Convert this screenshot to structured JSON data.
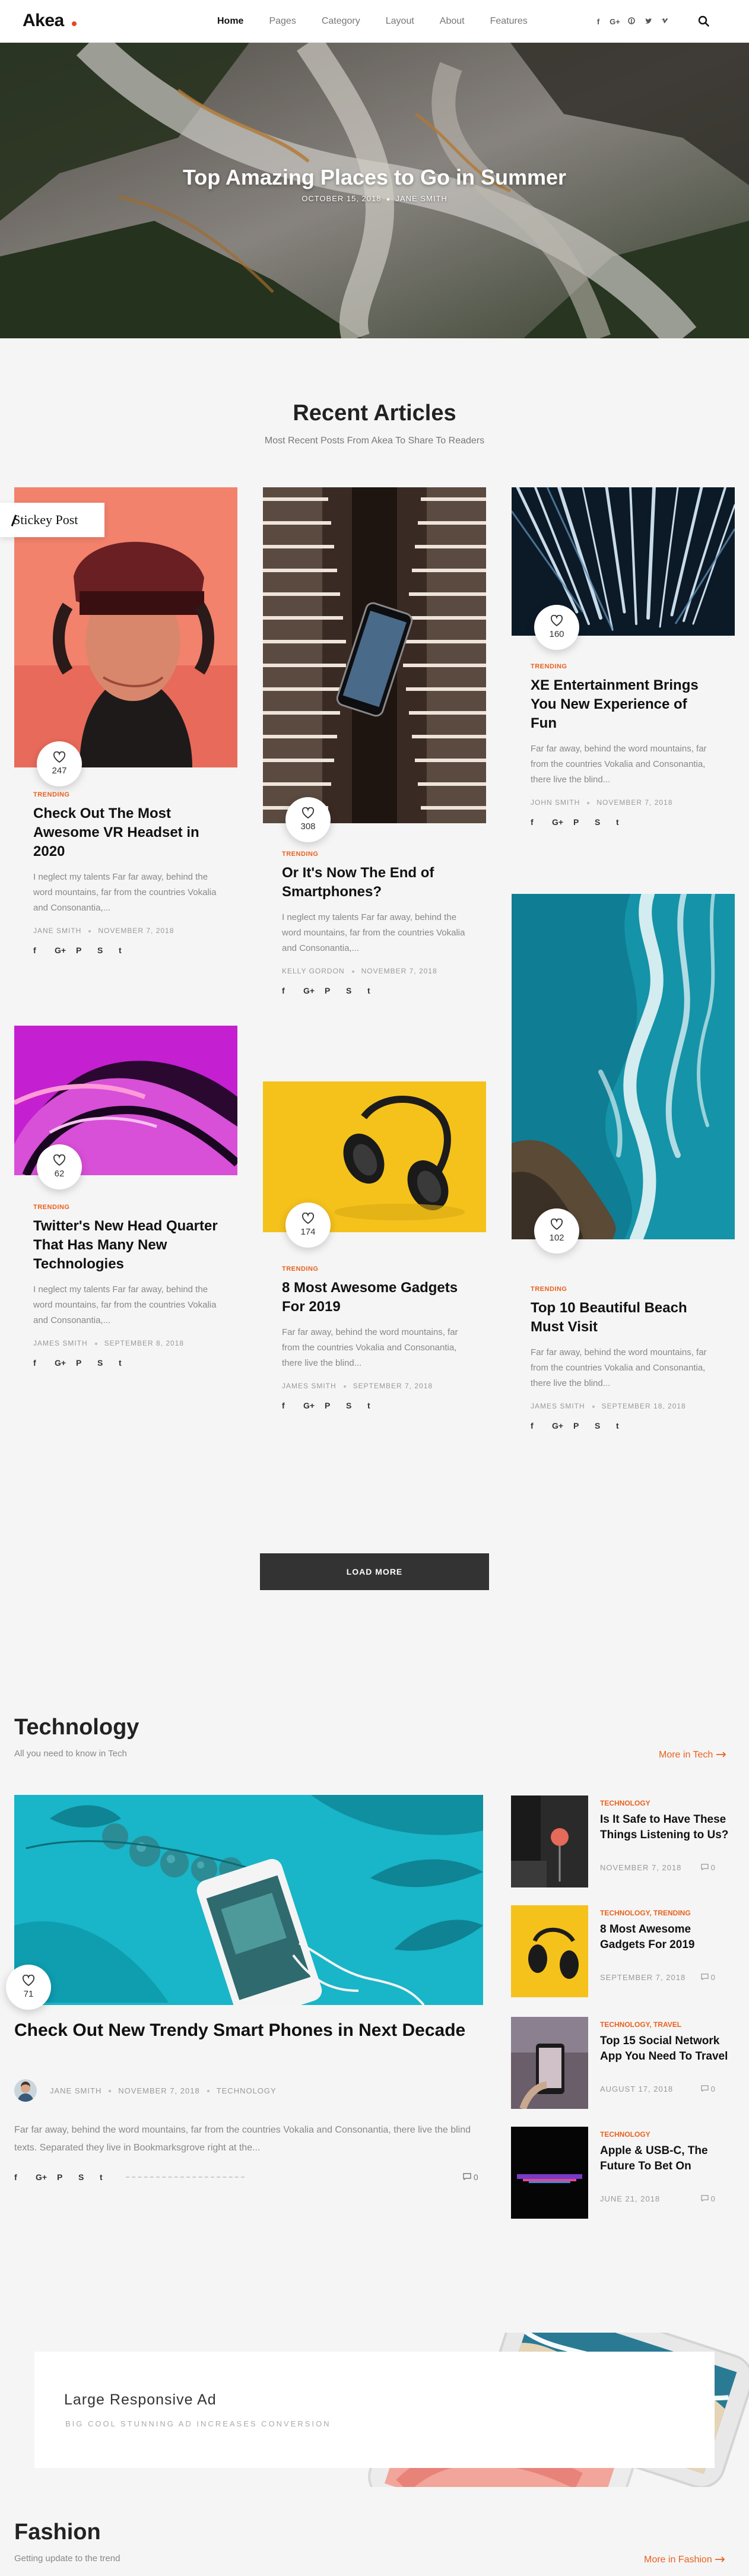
{
  "header": {
    "logo": "Akea",
    "nav": [
      "Home",
      "Pages",
      "Category",
      "Layout",
      "About",
      "Features"
    ],
    "social": [
      "f",
      "G+",
      "P",
      "t",
      "V"
    ]
  },
  "hero": {
    "title": "Top Amazing Places to Go in Summer",
    "date": "OCTOBER 15, 2018",
    "author": "JANE SMITH"
  },
  "recent": {
    "title": "Recent Articles",
    "subtitle": "Most Recent Posts From Akea To Share To Readers",
    "sticky": "Stickey Post",
    "share": [
      "f",
      "G+",
      "P",
      "S",
      "t"
    ],
    "cards": [
      {
        "likes": "247",
        "tag": "TRENDING",
        "title": "Check Out The Most Awesome VR Headset in 2020",
        "excerpt": "I neglect my talents Far far away, behind the word mountains, far from the countries Vokalia and Consonantia,...",
        "author": "JANE SMITH",
        "date": "NOVEMBER 7, 2018"
      },
      {
        "likes": "308",
        "tag": "TRENDING",
        "title": "Or It's Now The End of Smartphones?",
        "excerpt": "I neglect my talents Far far away, behind the word mountains, far from the countries Vokalia and Consonantia,...",
        "author": "KELLY GORDON",
        "date": "NOVEMBER 7, 2018"
      },
      {
        "likes": "160",
        "tag": "TRENDING",
        "title": "XE Entertainment Brings You New Experience of Fun",
        "excerpt": "Far far away, behind the word mountains, far from the countries Vokalia and Consonantia, there live the blind...",
        "author": "JOHN SMITH",
        "date": "NOVEMBER 7, 2018"
      },
      {
        "likes": "62",
        "tag": "TRENDING",
        "title": "Twitter's New Head Quarter That Has Many New Technologies",
        "excerpt": "I neglect my talents Far far away, behind the word mountains, far from the countries Vokalia and Consonantia,...",
        "author": "JAMES SMITH",
        "date": "SEPTEMBER 8, 2018"
      },
      {
        "likes": "174",
        "tag": "TRENDING",
        "title": "8 Most Awesome Gadgets For 2019",
        "excerpt": "Far far away, behind the word mountains, far from the countries Vokalia and Consonantia, there live the blind...",
        "author": "JAMES SMITH",
        "date": "SEPTEMBER 7, 2018"
      },
      {
        "likes": "102",
        "tag": "TRENDING",
        "title": "Top 10 Beautiful Beach Must Visit",
        "excerpt": "Far far away, behind the word mountains, far from the countries Vokalia and Consonantia, there live the blind...",
        "author": "JAMES SMITH",
        "date": "SEPTEMBER 18, 2018"
      }
    ],
    "load_more": "LOAD MORE"
  },
  "technology": {
    "title": "Technology",
    "subtitle": "All you need to know in Tech",
    "more": "More in Tech",
    "main": {
      "likes": "71",
      "title": "Check Out New Trendy Smart Phones in Next Decade",
      "author": "JANE SMITH",
      "date": "NOVEMBER 7, 2018",
      "category": "TECHNOLOGY",
      "excerpt": "Far far away, behind the word mountains, far from the countries Vokalia and Consonantia, there live the blind texts. Separated they live in Bookmarksgrove right at the...",
      "comments": "0"
    },
    "side": [
      {
        "cat": "TECHNOLOGY",
        "title": "Is It Safe to Have These Things Listening to Us?",
        "date": "NOVEMBER 7, 2018",
        "comments": "0"
      },
      {
        "cat": "TECHNOLOGY, TRENDING",
        "title": "8 Most Awesome Gadgets For 2019",
        "date": "SEPTEMBER 7, 2018",
        "comments": "0"
      },
      {
        "cat": "TECHNOLOGY, TRAVEL",
        "title": "Top 15 Social Network App You Need To Travel",
        "date": "AUGUST 17, 2018",
        "comments": "0"
      },
      {
        "cat": "TECHNOLOGY",
        "title": "Apple & USB-C, The Future To Bet On",
        "date": "JUNE 21, 2018",
        "comments": "0"
      }
    ]
  },
  "ad": {
    "title": "Large Responsive Ad",
    "subtitle": "BIG COOL STUNNING AD INCREASES CONVERSION"
  },
  "fashion": {
    "title": "Fashion",
    "subtitle": "Getting update to the trend",
    "more": "More in Fashion"
  },
  "colors": {
    "accent": "#e8611c",
    "logo_dot": "#e34a1d",
    "button": "#333333"
  },
  "icons": [
    "search-icon",
    "heart-icon",
    "comment-icon",
    "arrow-right-icon",
    "facebook-icon",
    "google-plus-icon",
    "pinterest-icon",
    "stumbleupon-icon",
    "twitter-icon",
    "vimeo-icon"
  ]
}
